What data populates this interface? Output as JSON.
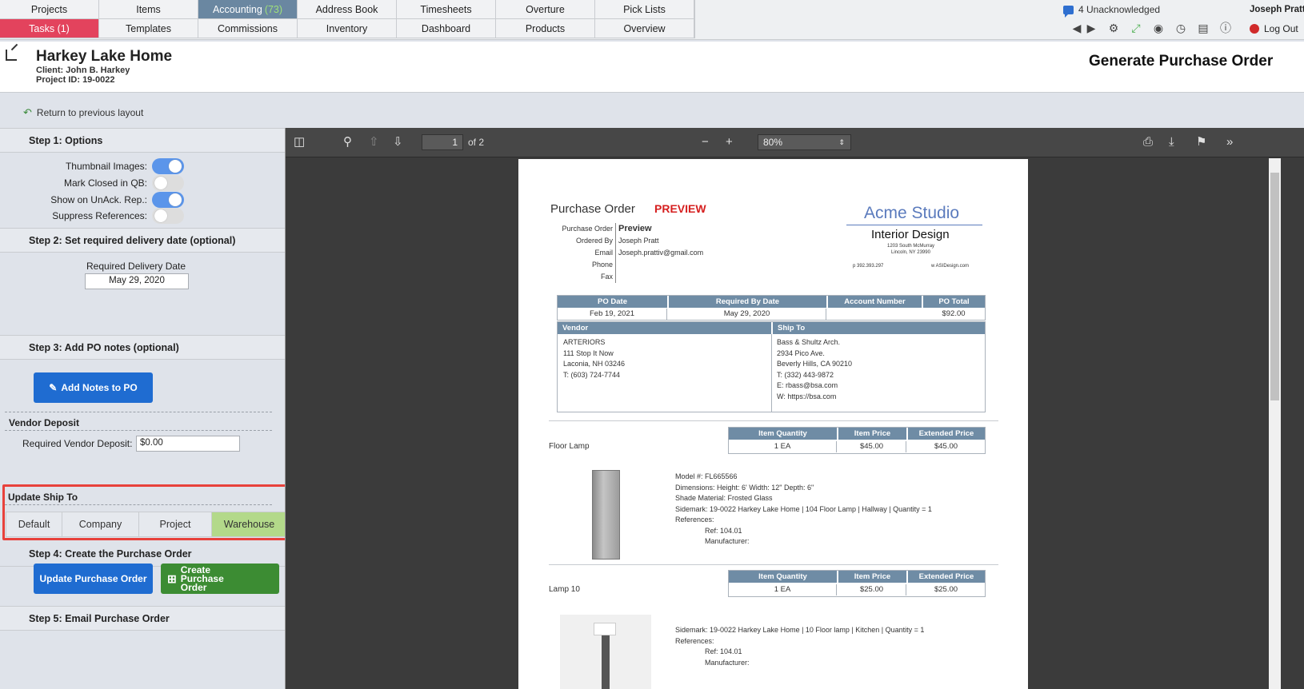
{
  "nav": {
    "row1": [
      "Projects",
      "Items",
      "Accounting",
      "Address Book",
      "Timesheets",
      "Overture",
      "Pick Lists"
    ],
    "accounting_count": "(73)",
    "row2": [
      "Tasks (1)",
      "Templates",
      "Commissions",
      "Inventory",
      "Dashboard",
      "Products",
      "Overview"
    ],
    "unack": "4 Unacknowledged",
    "user": "Joseph Pratt",
    "logout": "Log Out",
    "icons": [
      "arrow-left-icon",
      "arrow-right-icon",
      "gear-icon",
      "expand-icon",
      "user-icon",
      "clock-icon",
      "layout-icon",
      "info-icon"
    ]
  },
  "header": {
    "project_title": "Harkey Lake Home",
    "client": "Client: John B. Harkey",
    "project_id": "Project ID: 19-0022",
    "page_title": "Generate Purchase Order"
  },
  "return_link": "Return to previous layout",
  "left": {
    "step1": "Step 1: Options",
    "options": [
      {
        "label": "Thumbnail Images:",
        "on": true
      },
      {
        "label": "Mark Closed in QB:",
        "on": false
      },
      {
        "label": "Show on UnAck. Rep.:",
        "on": true
      },
      {
        "label": "Suppress References:",
        "on": false
      }
    ],
    "step2": "Step 2: Set required delivery date (optional)",
    "delivery_label": "Required Delivery Date",
    "delivery_value": "May 29, 2020",
    "step3": "Step 3: Add PO notes (optional)",
    "add_notes": "Add Notes to PO",
    "vendor_deposit": "Vendor Deposit",
    "deposit_label": "Required Vendor Deposit:",
    "deposit_value": "$0.00",
    "update_ship": "Update Ship To",
    "ship_options": [
      "Default",
      "Company",
      "Project",
      "Warehouse"
    ],
    "ship_selected": "Warehouse",
    "step4": "Step 4: Create the Purchase Order",
    "update_po": "Update Purchase Order",
    "create_po": [
      "Create",
      "Purchase",
      "Order"
    ],
    "step5": "Step 5: Email Purchase Order"
  },
  "viewer": {
    "page_num": "1",
    "page_of": "of 2",
    "zoom": "80%"
  },
  "po": {
    "title": "Purchase Order",
    "preview": "PREVIEW",
    "company": "Acme Studio",
    "company_sub": "Interior Design",
    "addr1": "1203 South McMurray",
    "addr2": "Lincoln, NY 23990",
    "phone": "p 392.393.297",
    "web": "w ASIDesign.com",
    "meta_labels": [
      "Purchase Order",
      "Ordered By",
      "Email",
      "Phone",
      "Fax"
    ],
    "meta_values": [
      "Preview",
      "Joseph Pratt",
      "Joseph.prattiv@gmail.com",
      "",
      ""
    ],
    "summary_headers": [
      "PO Date",
      "Required By Date",
      "Account Number",
      "PO Total"
    ],
    "summary_values": [
      "Feb 19, 2021",
      "May 29, 2020",
      "",
      "$92.00"
    ],
    "vendor_header": "Vendor",
    "vendor_lines": [
      "ARTERIORS",
      "111 Stop It Now",
      "Laconia, NH 03246",
      "T: (603) 724-7744"
    ],
    "shipto_header": "Ship To",
    "shipto_lines": [
      "Bass & Shultz Arch.",
      "2934 Pico Ave.",
      "Beverly Hills, CA 90210",
      "T: (332) 443-9872",
      "E: rbass@bsa.com",
      "W: https://bsa.com"
    ],
    "item_headers": [
      "Item Quantity",
      "Item Price",
      "Extended Price"
    ],
    "items": [
      {
        "name": "Floor Lamp",
        "qty": "1 EA",
        "price": "$45.00",
        "ext": "$45.00",
        "details": [
          "Model #: FL665566",
          "Dimensions: Height: 6' Width: 12\" Depth: 6\"",
          "Shade Material: Frosted Glass",
          "Sidemark: 19-0022 Harkey Lake Home  |  104 Floor Lamp  |  Hallway  |   Quantity = 1",
          "References:"
        ],
        "refs": [
          "Ref: 104.01",
          "Manufacturer:"
        ]
      },
      {
        "name": "Lamp 10",
        "qty": "1 EA",
        "price": "$25.00",
        "ext": "$25.00",
        "details": [
          "Sidemark: 19-0022 Harkey Lake Home  |  10 Floor lamp  |  Kitchen  |   Quantity = 1",
          "References:"
        ],
        "refs": [
          "Ref: 104.01",
          "Manufacturer:"
        ]
      }
    ]
  }
}
